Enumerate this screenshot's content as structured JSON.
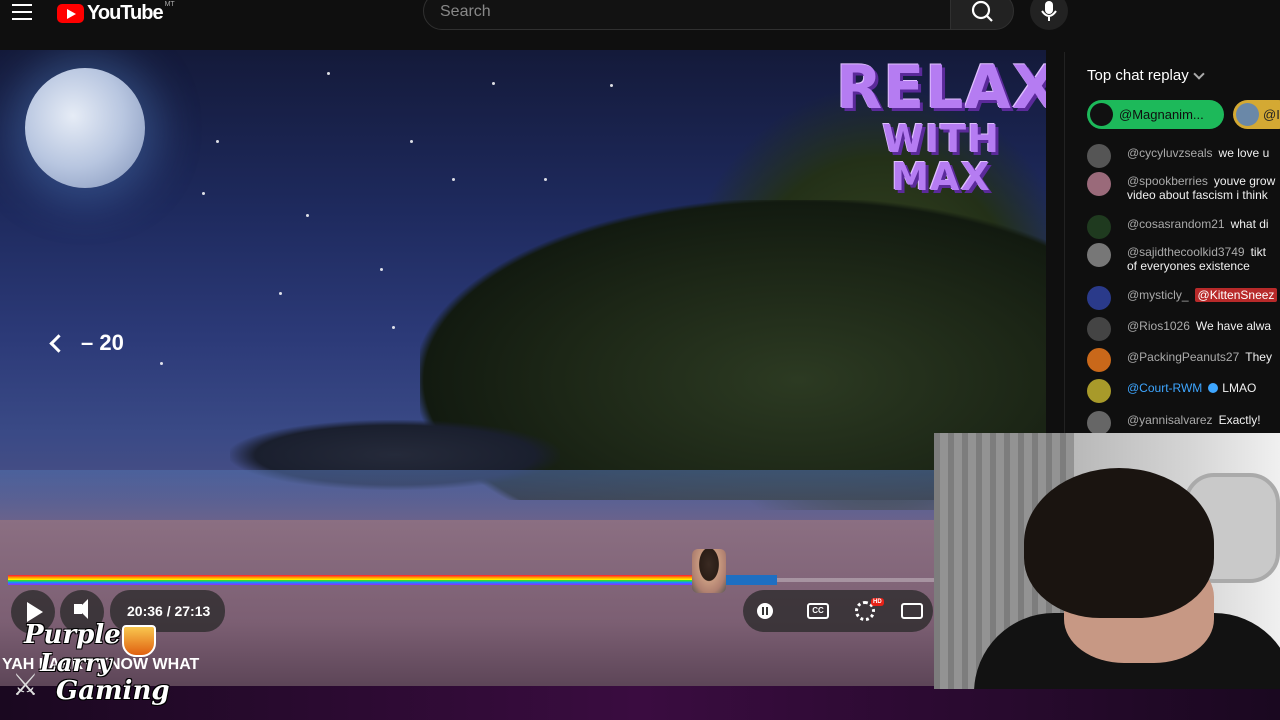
{
  "header": {
    "logo_text": "YouTube",
    "logo_sup": "MT",
    "search_placeholder": "Search"
  },
  "video": {
    "overlay_title_line1": "RELAX",
    "overlay_title_line2": "WITH MAX",
    "seek_back_label": "– 20",
    "time_display": "20:36 / 27:13",
    "progress_fraction": 0.757,
    "buffer_fraction": 0.83,
    "caption_text": "YAH LARRY KNOW WHAT",
    "watermark_line1": "Purple",
    "watermark_line2": "Larry",
    "watermark_line3": "Gaming",
    "hd_badge": "HD",
    "cc_label": "CC"
  },
  "chat": {
    "header": "Top chat replay",
    "pinned": [
      {
        "name": "@Magnanim..."
      },
      {
        "name": "@I"
      }
    ],
    "messages": [
      {
        "author": "@cycyluvzseals",
        "text": "we love u",
        "style": "gray"
      },
      {
        "author": "@spookberries",
        "text": "youve grow",
        "text2": "video about fascism i think",
        "style": "gray"
      },
      {
        "author": "@cosasrandom21",
        "text": "what di",
        "style": "gray"
      },
      {
        "author": "@sajidthecoolkid3749",
        "text": "tikt",
        "text2": "of everyones existence",
        "style": "gray"
      },
      {
        "author": "@mysticly_",
        "text": "",
        "mention": "@KittenSneez",
        "style": "gray"
      },
      {
        "author": "@Rios1026",
        "text": "We have alwa",
        "style": "gray"
      },
      {
        "author": "@PackingPeanuts27",
        "text": "They",
        "style": "gray"
      },
      {
        "author": "@Court-RWM",
        "text": "LMAO",
        "style": "blue"
      },
      {
        "author": "@yannisalvarez",
        "text": "Exactly!",
        "style": "gray"
      }
    ]
  },
  "colors": {
    "accent_red": "#ff0000",
    "pinned_green": "#1db95a",
    "relax_purple": "#b57cf2"
  },
  "icons": [
    "menu-icon",
    "youtube-logo",
    "search-icon",
    "mic-icon",
    "chevron-left-icon",
    "play-icon",
    "volume-icon",
    "pause-icon",
    "cc-icon",
    "gear-icon",
    "theater-icon",
    "chevron-down-icon"
  ]
}
